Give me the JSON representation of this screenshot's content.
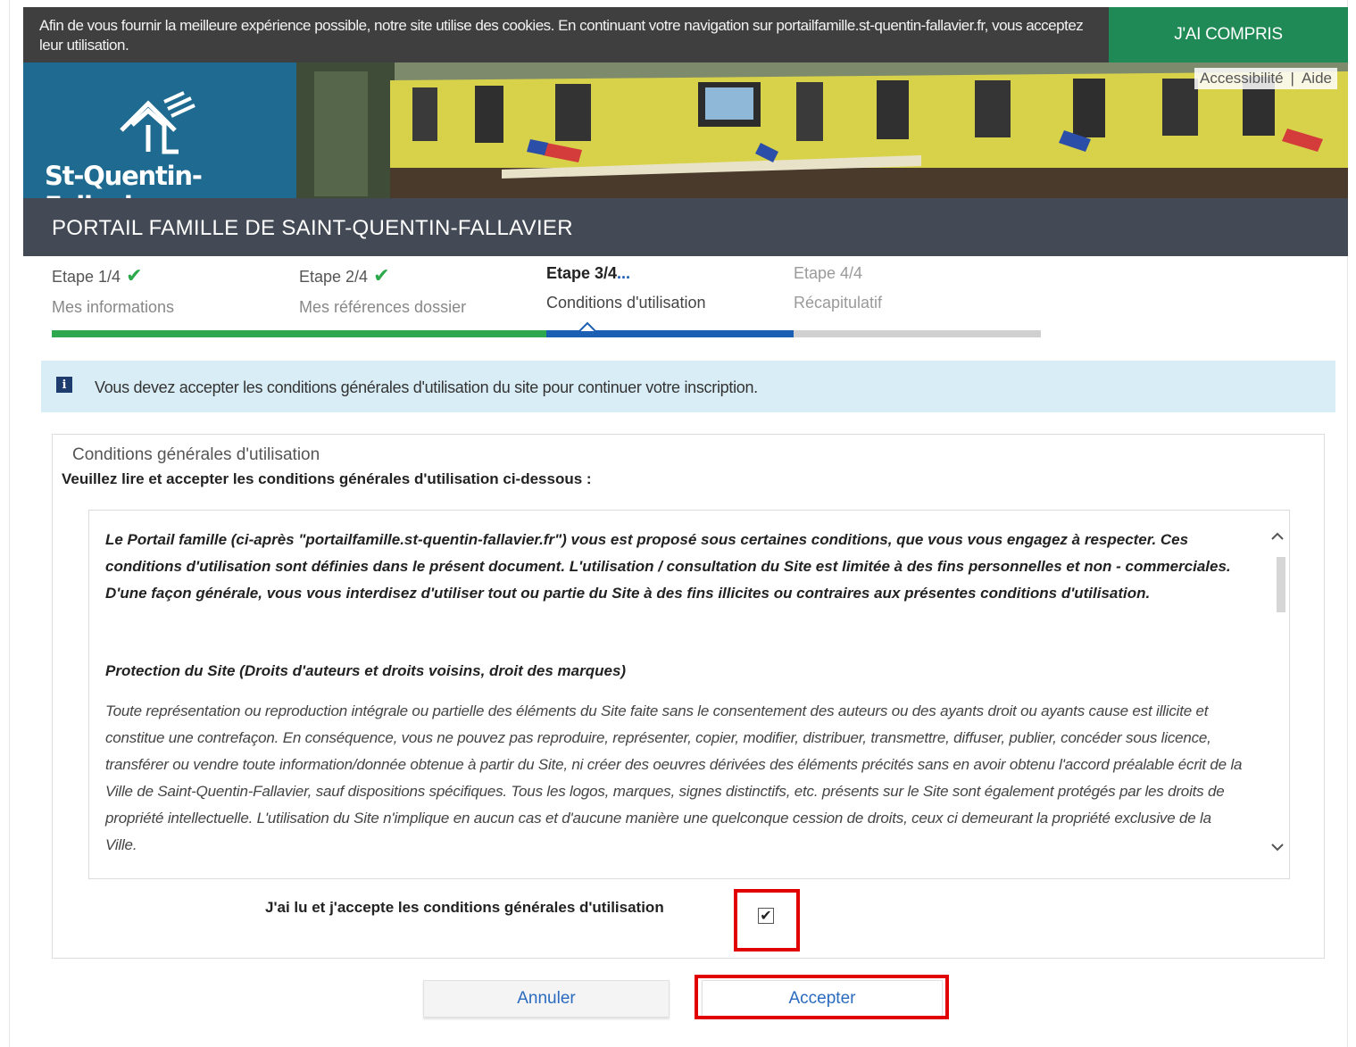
{
  "cookie": {
    "text": "Afin de vous fournir la meilleure expérience possible, notre site utilise des cookies. En continuant votre navigation sur portailfamille.st-quentin-fallavier.fr, vous acceptez leur utilisation.",
    "button": "J'AI COMPRIS"
  },
  "header": {
    "logo_text": "St-Quentin-Fallavier",
    "links": [
      "Accessibilité",
      "Aide"
    ],
    "link_separator": "|",
    "portal_title": "PORTAIL FAMILLE DE SAINT-QUENTIN-FALLAVIER"
  },
  "steps": [
    {
      "label": "Etape 1/4",
      "sub": "Mes informations",
      "state": "done"
    },
    {
      "label": "Etape 2/4",
      "sub": "Mes références dossier",
      "state": "done"
    },
    {
      "label": "Etape 3/4",
      "sub": "Conditions d'utilisation",
      "state": "current",
      "indicator": "..."
    },
    {
      "label": "Etape 4/4",
      "sub": "Récapitulatif",
      "state": "pending"
    }
  ],
  "progress": {
    "completed_fraction": 0.5,
    "current_fraction": 0.75
  },
  "info_message": "Vous devez accepter les conditions générales d'utilisation du site pour continuer votre inscription.",
  "conditions": {
    "legend": "Conditions générales d'utilisation",
    "instruction": "Veuillez lire et accepter les conditions générales d'utilisation ci-dessous :",
    "intro": "Le Portail famille (ci-après \"portailfamille.st-quentin-fallavier.fr\") vous est proposé sous certaines conditions, que vous vous engagez à respecter. Ces conditions d'utilisation sont définies dans le présent document. L'utilisation / consultation du Site est limitée à des fins personnelles et non - commerciales. D'une façon générale, vous vous interdisez d'utiliser tout ou partie du Site à des fins illicites ou contraires aux présentes conditions d'utilisation.",
    "section_heading": "Protection du Site (Droits d'auteurs et droits voisins, droit des marques)",
    "section_text": "Toute représentation ou reproduction intégrale ou partielle des éléments du Site faite sans le consentement des auteurs ou des ayants droit ou ayants cause est illicite et constitue une contrefaçon. En conséquence, vous ne pouvez pas reproduire, représenter, copier, modifier, distribuer, transmettre, diffuser, publier, concéder sous licence, transférer ou vendre toute information/donnée obtenue à partir du Site, ni créer des oeuvres dérivées des éléments précités sans en avoir obtenu l'accord préalable écrit de la Ville de Saint-Quentin-Fallavier, sauf dispositions spécifiques. Tous les logos, marques, signes distinctifs, etc. présents sur le Site sont également protégés par les droits de propriété intellectuelle. L'utilisation du Site n'implique en aucun cas et d'aucune manière une quelconque cession de droits, ceux ci demeurant la propriété exclusive de la Ville.",
    "accept_label": "J'ai lu et j'accepte les conditions générales d'utilisation",
    "accepted": true
  },
  "buttons": {
    "cancel": "Annuler",
    "accept": "Accepter"
  },
  "colors": {
    "cookie_bg": "#3f3f3f",
    "cookie_button": "#1f8a55",
    "logo_bg": "#1e6a90",
    "title_bar": "#434a55",
    "progress_done": "#2ea84e",
    "progress_current": "#1a5fb4",
    "info_bg": "#d9edf7",
    "highlight": "#e00000"
  }
}
